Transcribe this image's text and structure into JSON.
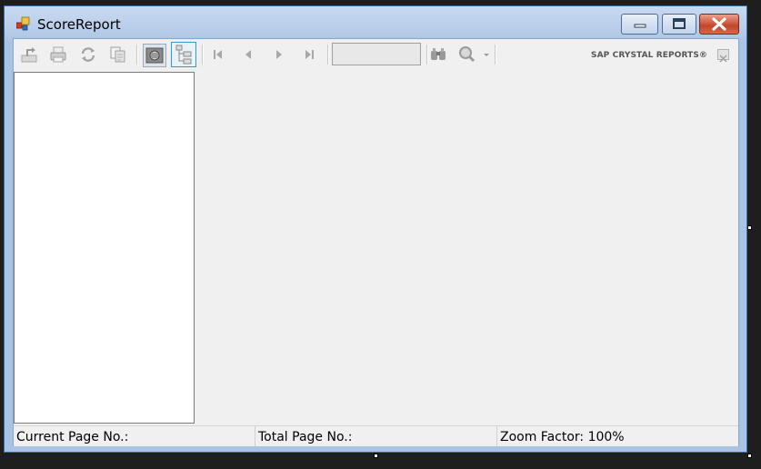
{
  "window": {
    "title": "ScoreReport"
  },
  "toolbar": {
    "buttons": [
      {
        "name": "export-icon"
      },
      {
        "name": "print-icon"
      },
      {
        "name": "refresh-icon"
      },
      {
        "name": "copy-icon"
      },
      {
        "name": "group-tree-toggle-icon"
      },
      {
        "name": "parameter-panel-icon"
      },
      {
        "name": "first-page-icon"
      },
      {
        "name": "previous-page-icon"
      },
      {
        "name": "next-page-icon"
      },
      {
        "name": "last-page-icon"
      },
      {
        "name": "find-icon"
      },
      {
        "name": "zoom-icon"
      }
    ],
    "page_input_value": "",
    "brand": "SAP CRYSTAL REPORTS®"
  },
  "status_bar": {
    "current_page": "Current Page No.:",
    "total_page": "Total Page No.:",
    "zoom_factor": "Zoom Factor: 100%"
  }
}
